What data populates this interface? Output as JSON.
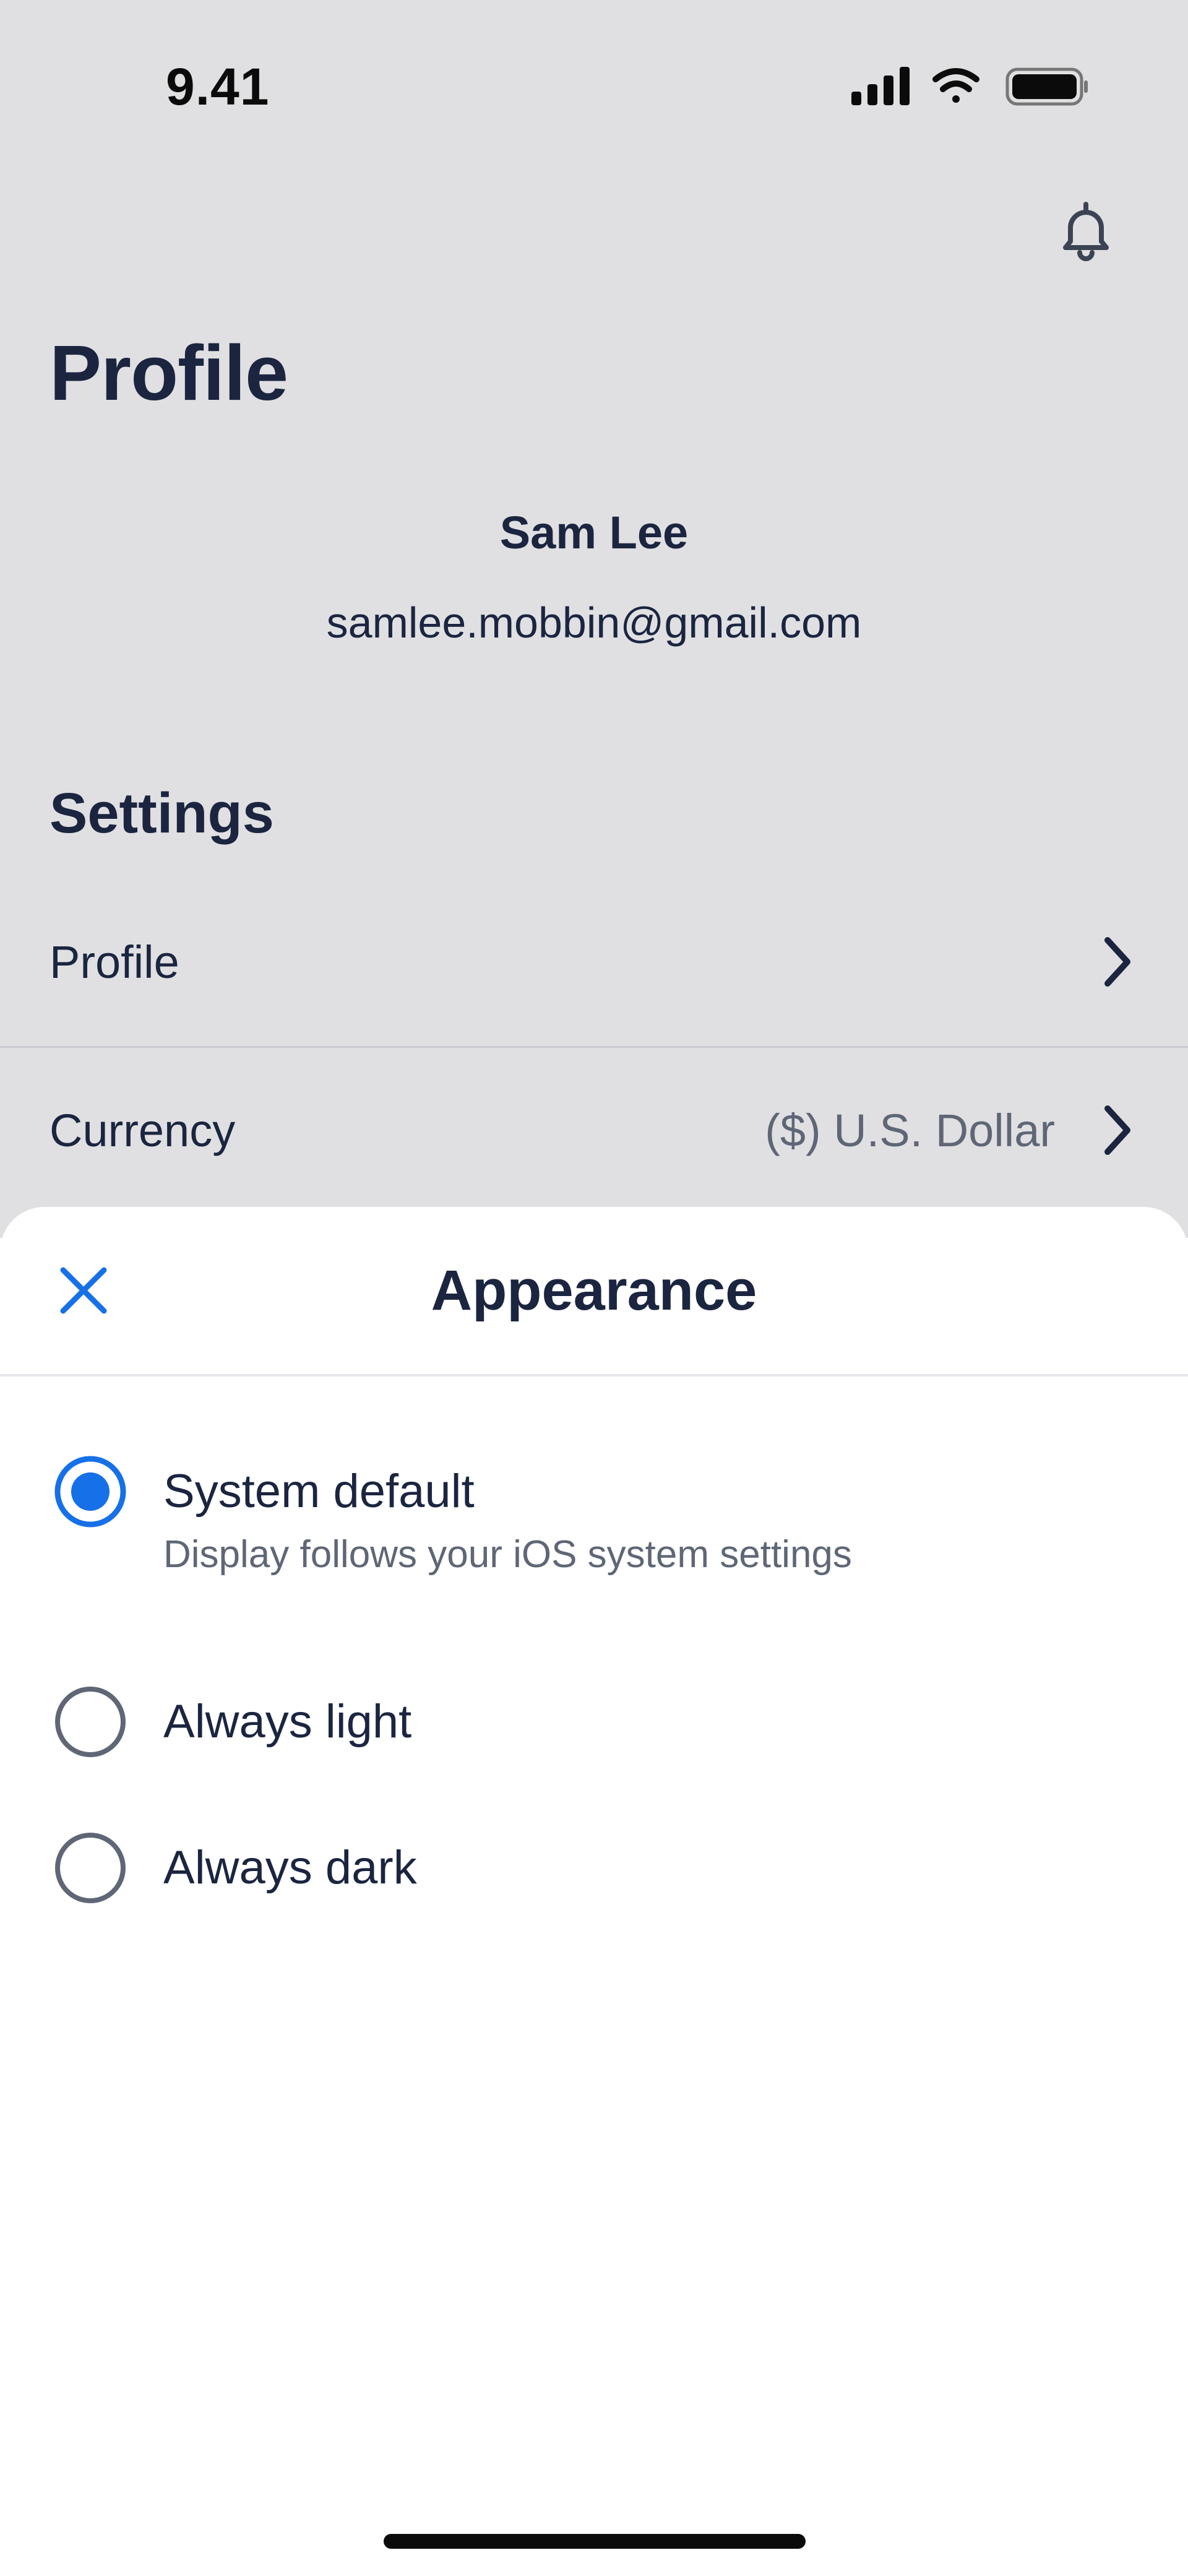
{
  "status_bar": {
    "time": "9.41",
    "icons": [
      "cellular-signal-icon",
      "wifi-icon",
      "battery-icon"
    ]
  },
  "header": {
    "title": "Profile",
    "notification_icon": "bell-icon"
  },
  "user": {
    "name": "Sam Lee",
    "email": "samlee.mobbin@gmail.com"
  },
  "settings": {
    "title": "Settings",
    "items": [
      {
        "label": "Profile",
        "value": "",
        "icon": "chevron-right-icon"
      },
      {
        "label": "Currency",
        "value": "($) U.S. Dollar",
        "icon": "chevron-right-icon"
      }
    ]
  },
  "sheet": {
    "title": "Appearance",
    "close_icon": "close-icon",
    "options": [
      {
        "label": "System default",
        "description": "Display follows your iOS system settings",
        "selected": true
      },
      {
        "label": "Always light",
        "description": "",
        "selected": false
      },
      {
        "label": "Always dark",
        "description": "",
        "selected": false
      }
    ]
  },
  "colors": {
    "accent": "#1670e8",
    "text_primary": "#1b2540",
    "text_secondary": "#5f6675",
    "background_dimmed": "#e0e0e2",
    "sheet_background": "#ffffff"
  }
}
